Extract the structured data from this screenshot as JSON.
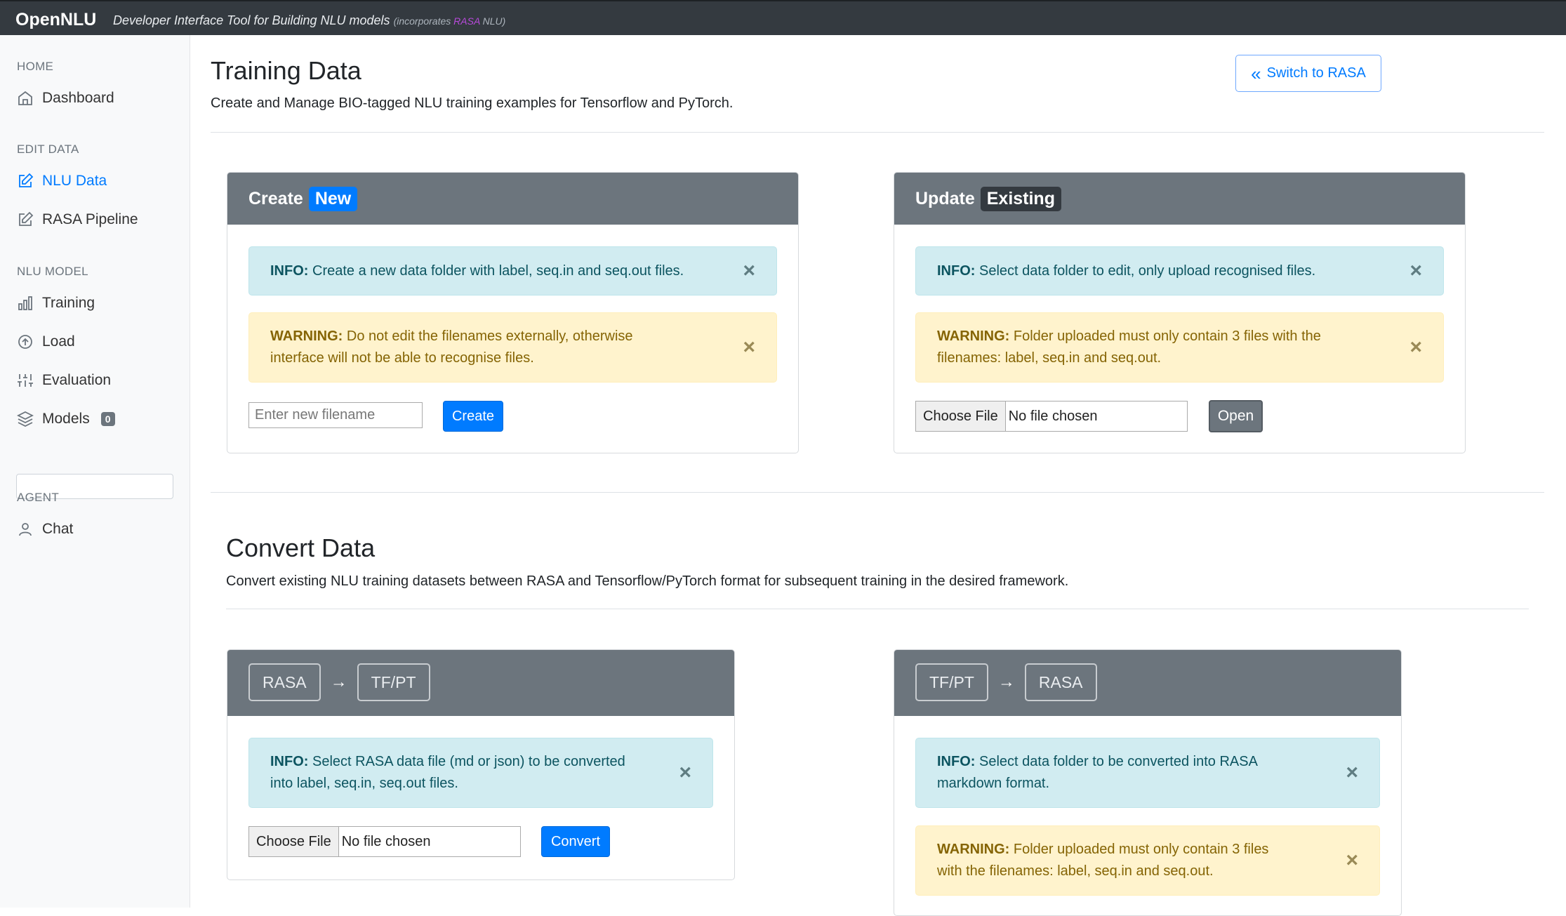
{
  "topbar": {
    "brand": "OpenNLU",
    "tagline": "Developer Interface Tool for Building NLU models",
    "tagline_prefix": "(incorporates",
    "tagline_rasa": "RASA",
    "tagline_suffix": "NLU)"
  },
  "sidebar": {
    "home_heading": "HOME",
    "dashboard": "Dashboard",
    "edit_heading": "EDIT DATA",
    "nlu_data": "NLU Data",
    "rasa_pipeline": "RASA Pipeline",
    "model_heading": "NLU MODEL",
    "training": "Training",
    "load": "Load",
    "evaluation": "Evaluation",
    "models": "Models",
    "models_count": "0",
    "agent_heading": "AGENT",
    "chat": "Chat"
  },
  "header": {
    "title": "Training Data",
    "subtitle": "Create and Manage BIO-tagged NLU training examples for Tensorflow and PyTorch.",
    "switch_button": "Switch to RASA"
  },
  "create_card": {
    "title": "Create",
    "badge": "New",
    "info_label": "INFO:",
    "info_text": "Create a new data folder with label, seq.in and seq.out files.",
    "warning_label": "WARNING:",
    "warning_text_1": "Do not edit the filenames externally, otherwise",
    "warning_text_2": "interface will not be able to recognise files.",
    "filename_placeholder": "Enter new filename",
    "create_button": "Create"
  },
  "update_card": {
    "title": "Update",
    "badge": "Existing",
    "info_label": "INFO:",
    "info_text": "Select data folder to edit, only upload recognised files.",
    "warning_label": "WARNING:",
    "warning_text_1": "Folder uploaded must only contain 3 files with the",
    "warning_text_2": "filenames: label, seq.in and seq.out.",
    "choose_file": "Choose File",
    "no_file": "No file chosen",
    "open_button": "Open"
  },
  "convert": {
    "title": "Convert Data",
    "subtitle": "Convert existing NLU training datasets between RASA and Tensorflow/PyTorch format for subsequent training in the desired framework.",
    "left": {
      "from": "RASA",
      "to": "TF/PT",
      "info_label": "INFO:",
      "info_text_1": "Select RASA data file (md or json) to be converted",
      "info_text_2": "into label, seq.in, seq.out files.",
      "choose_file": "Choose File",
      "no_file": "No file chosen",
      "convert_button": "Convert"
    },
    "right": {
      "from": "TF/PT",
      "to": "RASA",
      "info_label": "INFO:",
      "info_text_1": "Select data folder to be converted into RASA",
      "info_text_2": "markdown format.",
      "warning_label": "WARNING:",
      "warning_text_1": "Folder uploaded must only contain 3 files",
      "warning_text_2": "with the filenames: label, seq.in and seq.out."
    }
  },
  "symbols": {
    "close": "×",
    "arrow": "→",
    "double_left": "«"
  },
  "colors": {
    "primary": "#007bff",
    "secondary": "#6c757d",
    "dark": "#343a40",
    "info_bg": "#d1ecf1",
    "warning_bg": "#fff3cd"
  }
}
